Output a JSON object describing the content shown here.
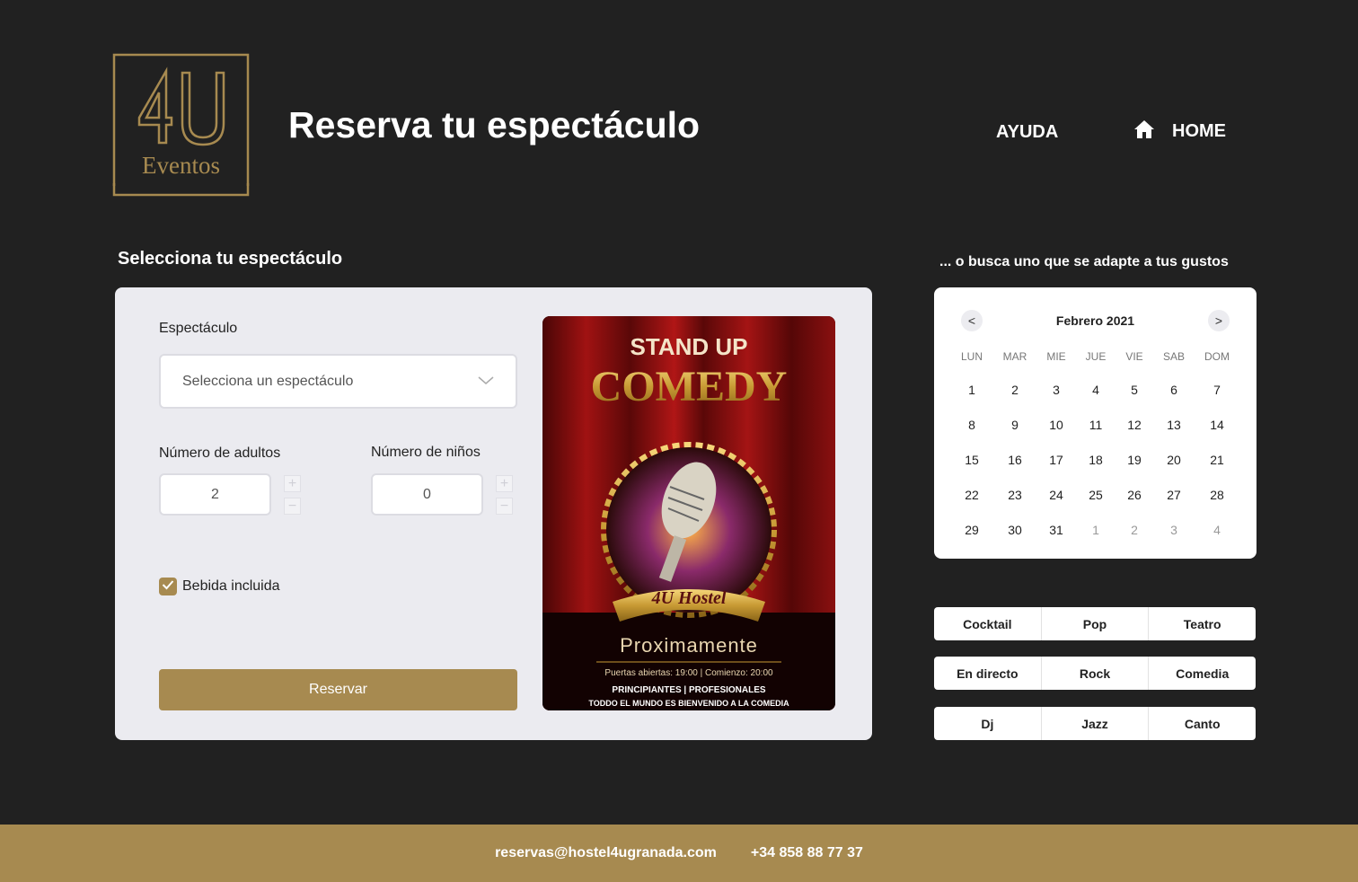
{
  "header": {
    "logo_text": "4U",
    "logo_subtext": "Eventos",
    "title": "Reserva tu espectáculo",
    "nav": {
      "help": "AYUDA",
      "home": "HOME"
    }
  },
  "left_section": {
    "title": "Selecciona tu espectáculo",
    "show_label": "Espectáculo",
    "show_placeholder": "Selecciona un espectáculo",
    "adults_label": "Número de adultos",
    "adults_value": "2",
    "children_label": "Número de niños",
    "children_value": "0",
    "drink_label": "Bebida incluida",
    "drink_checked": true,
    "reserve_button": "Reservar"
  },
  "poster": {
    "line1": "STAND UP",
    "line2": "COMEDY",
    "ribbon": "4U Hostel",
    "subtitle": "Proximamente",
    "schedule": "Puertas abiertas: 19:00 | Comienzo: 20:00",
    "levels": "PRINCIPIANTES | PROFESIONALES",
    "tagline": "TODDO EL MUNDO ES BIENVENIDO A LA COMEDIA"
  },
  "right_section": {
    "title": "... o busca uno que se adapte a tus gustos",
    "calendar": {
      "month": "Febrero 2021",
      "prev": "<",
      "next": ">",
      "weekdays": [
        "LUN",
        "MAR",
        "MIE",
        "JUE",
        "VIE",
        "SAB",
        "DOM"
      ],
      "weeks": [
        [
          "1",
          "2",
          "3",
          "4",
          "5",
          "6",
          "7"
        ],
        [
          "8",
          "9",
          "10",
          "11",
          "12",
          "13",
          "14"
        ],
        [
          "15",
          "16",
          "17",
          "18",
          "19",
          "20",
          "21"
        ],
        [
          "22",
          "23",
          "24",
          "25",
          "26",
          "27",
          "28"
        ],
        [
          "29",
          "30",
          "31",
          "1",
          "2",
          "3",
          "4"
        ]
      ]
    },
    "tags": [
      [
        "Cocktail",
        "Pop",
        "Teatro"
      ],
      [
        "En directo",
        "Rock",
        "Comedia"
      ],
      [
        "Dj",
        "Jazz",
        "Canto"
      ]
    ]
  },
  "footer": {
    "email": "reservas@hostel4ugranada.com",
    "phone": "+34 858 88 77 37"
  },
  "colors": {
    "background": "#212121",
    "gold": "#a78a50",
    "card": "#ebebf0"
  }
}
